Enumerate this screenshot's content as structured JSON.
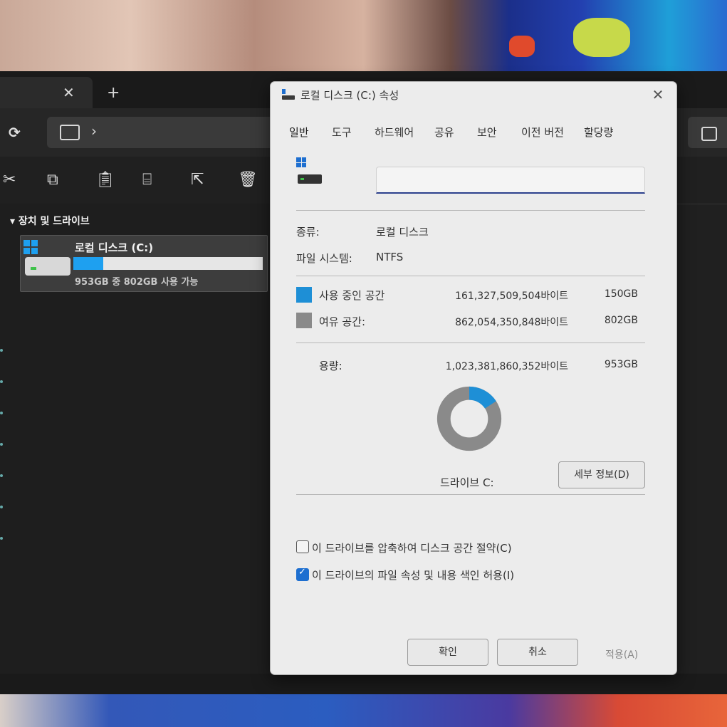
{
  "explorer": {
    "tab": {
      "close_glyph": "✕",
      "new_glyph": "+"
    },
    "address": {
      "chevron": "›"
    },
    "search_glyph": "대",
    "nav": {
      "header": "▾ 장치 및 드라이브",
      "drive": {
        "name": "로컬 디스크 (C:)",
        "usage_fraction": 0.157,
        "subtitle": "953GB 중 802GB 사용 가능"
      }
    },
    "status": "​",
    "commands": [
      "cut-icon",
      "copy-icon",
      "paste-icon",
      "rename-icon",
      "share-icon",
      "delete-icon"
    ]
  },
  "dialog": {
    "title": "로컬 디스크 (C:) 속성",
    "close_glyph": "✕",
    "tabs": [
      "일반",
      "도구",
      "하드웨어",
      "공유",
      "보안",
      "이전 버전",
      "할당량"
    ],
    "active_tab": "일반",
    "name_value": "",
    "type_label": "종류:",
    "type_value": "로컬 디스크",
    "fs_label": "파일 시스템:",
    "fs_value": "NTFS",
    "used_label": "사용 중인 공간",
    "used_bytes": "161,327,509,504바이트",
    "used_size": "150GB",
    "free_label": "여유 공간:",
    "free_bytes": "862,054,350,848바이트",
    "free_size": "802GB",
    "capacity_label": "용량:",
    "capacity_bytes": "1,023,381,860,352바이트",
    "capacity_size": "953GB",
    "used_fraction": 0.1576,
    "drive_label": "드라이브 C:",
    "details_button": "세부 정보(D)",
    "compress_label": "이 드라이브를 압축하여 디스크 공간 절약(C)",
    "compress_checked": false,
    "index_label": "이 드라이브의 파일 속성 및 내용 색인 허용(I)",
    "index_checked": true,
    "ok_button": "확인",
    "cancel_button": "취소",
    "apply_button": "적용(A)"
  },
  "colors": {
    "used": "#1e8fd6",
    "free": "#8a8a8a",
    "accent": "#1e6fd0"
  }
}
